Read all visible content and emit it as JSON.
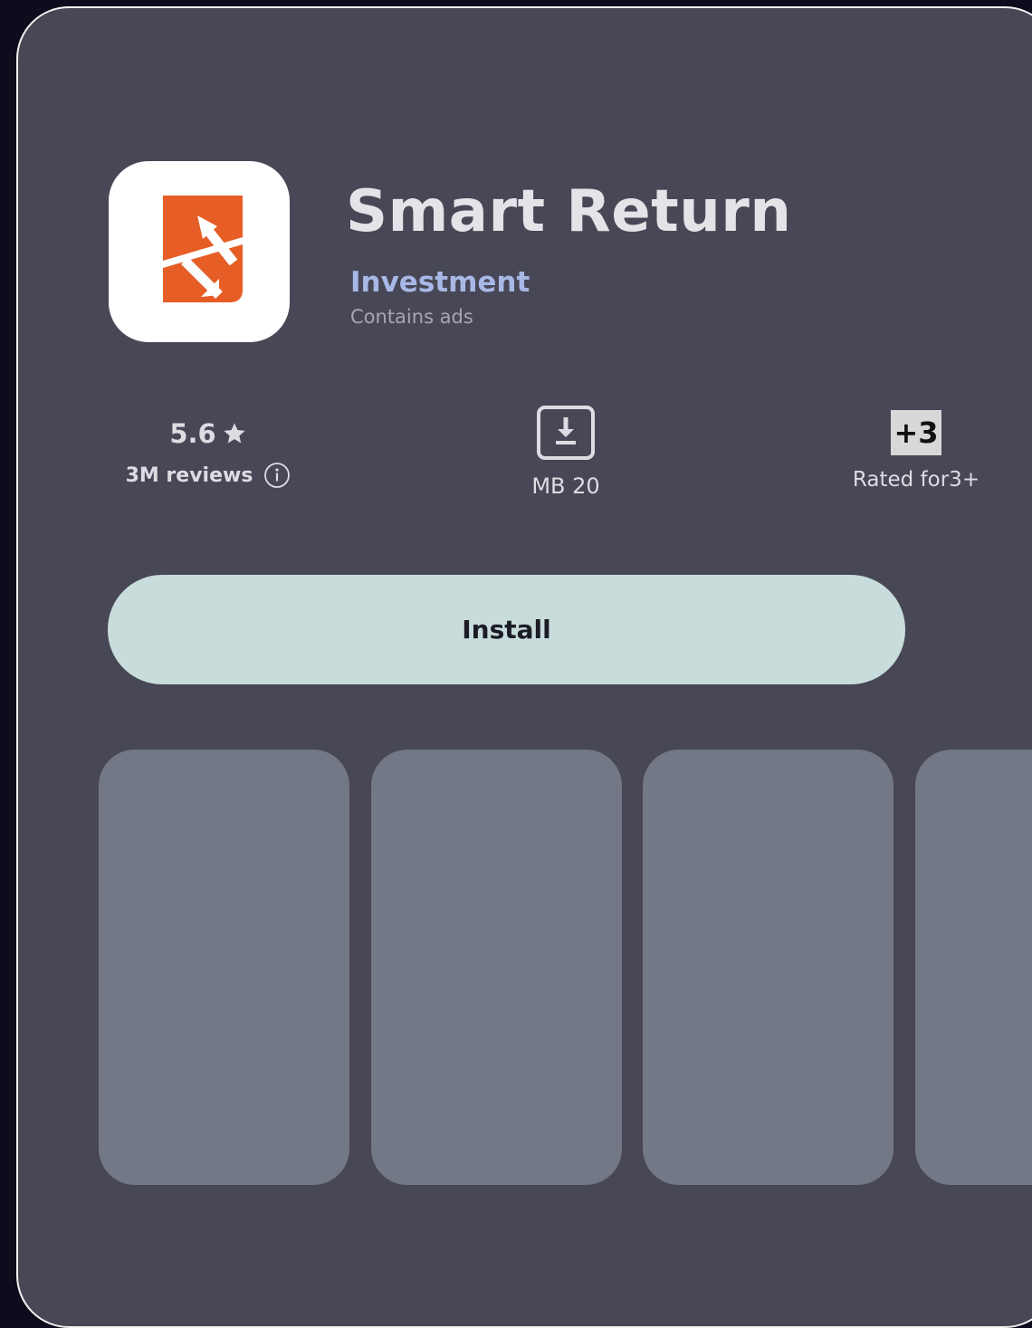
{
  "app": {
    "title": "Smart Return",
    "category": "Investment",
    "ads_notice": "Contains ads",
    "icon": "smart-return-logo",
    "icon_color": "#e65d26"
  },
  "stats": {
    "rating": "5.6",
    "reviews": "3M reviews",
    "size": "MB 20",
    "age_badge": "+3",
    "age_label": "Rated for3+"
  },
  "actions": {
    "install_label": "Install"
  },
  "screenshots": {
    "count": 4,
    "placeholder_color": "#727885"
  },
  "colors": {
    "background": "#484756",
    "install_button": "#c8dcdb",
    "category": "#a8b8e6"
  }
}
